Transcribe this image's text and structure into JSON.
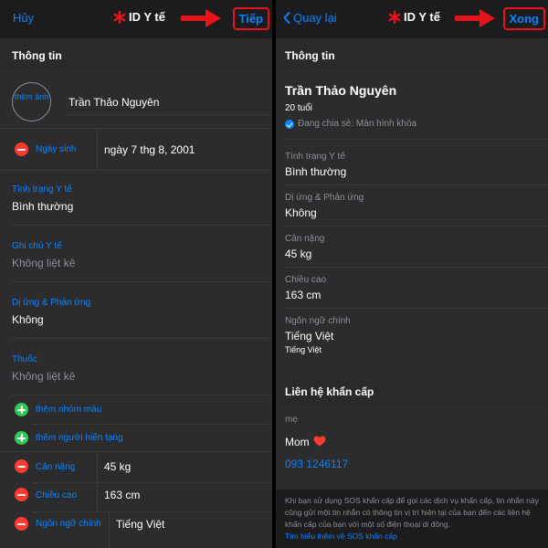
{
  "left": {
    "nav": {
      "cancel": "Hủy",
      "title": "ID Y tế",
      "next": "Tiếp"
    },
    "section_title": "Thông tin",
    "photo_label": "thêm ảnh",
    "name": "Trần Thảo Nguyên",
    "birthday_label": "Ngày sinh",
    "birthday_value": "ngày 7 thg 8, 2001",
    "medical_conditions_label": "Tình trạng Y tế",
    "medical_conditions_value": "Bình thường",
    "medical_notes_label": "Ghi chú Y tế",
    "medical_notes_value": "Không liệt kê",
    "allergies_label": "Dị ứng & Phản ứng",
    "allergies_value": "Không",
    "medications_label": "Thuốc",
    "medications_value": "Không liệt kê",
    "add_blood_type": "thêm nhóm máu",
    "add_organ_donor": "thêm người hiến tạng",
    "weight_label": "Cân nặng",
    "weight_value": "45 kg",
    "height_label": "Chiều cao",
    "height_value": "163 cm",
    "language_label": "Ngôn ngữ chính",
    "language_value": "Tiếng Việt"
  },
  "right": {
    "nav": {
      "back": "Quay lại",
      "title": "ID Y tế",
      "done": "Xong"
    },
    "section_title": "Thông tin",
    "name": "Trần Thảo Nguyên",
    "age": "20 tuổi",
    "sharing_status": "Đang chia sẻ: Màn hình khóa",
    "medical_conditions_label": "Tình trạng Y tế",
    "medical_conditions_value": "Bình thường",
    "allergies_label": "Dị ứng & Phản ứng",
    "allergies_value": "Không",
    "weight_label": "Cân nặng",
    "weight_value": "45 kg",
    "height_label": "Chiều cao",
    "height_value": "163 cm",
    "language_label": "Ngôn ngữ chính",
    "language_value": "Tiếng Việt",
    "language_sub": "Tiếng Việt",
    "emergency_title": "Liên hệ khẩn cấp",
    "contact_relation": "mẹ",
    "contact_name": "Mom",
    "contact_phone": "093 1246117",
    "footer_text": "Khi bạn sử dụng SOS khẩn cấp để gọi các dịch vụ khẩn cấp, tin nhắn này cũng gửi một tin nhắn có thông tin vị trí hiện tại của bạn đến các liên hệ khẩn cấp của bạn với một số điện thoại di động.",
    "footer_link": "Tìm hiểu thêm về SOS khẩn cấp"
  },
  "colors": {
    "accent": "#0a84ff",
    "annotation_red": "#e8121b",
    "delete_red": "#ff3b30",
    "add_green": "#34c759",
    "background": "#1c1c1e"
  },
  "icons": [
    "medical-star-icon",
    "red-arrow-icon",
    "chevron-left-icon",
    "remove-circle-icon",
    "add-circle-icon",
    "check-badge-icon",
    "heart-icon"
  ]
}
